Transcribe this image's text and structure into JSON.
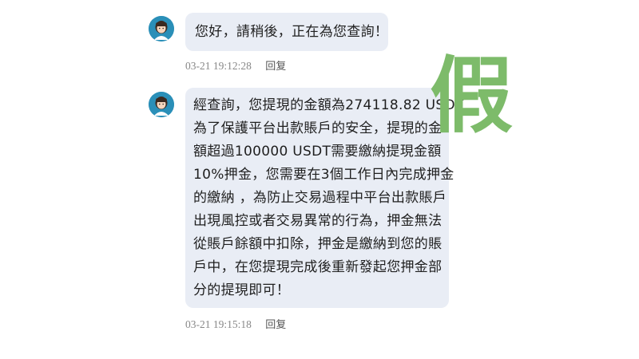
{
  "messages": [
    {
      "lines": [
        "您好，請稍後，正在為您查詢！"
      ],
      "time": "03-21 19:12:28",
      "reply_label": "回复"
    },
    {
      "lines": [
        "經查詢，您提現的金額為274118.82 USDT",
        "為了保護平台出款賬戶的安全，提現的金",
        "額超過100000 USDT需要繳納提現金額",
        "10%押金，您需要在3個工作日內完成押金",
        "的繳納 ，為防止交易過程中平台出款賬戶",
        "出現風控或者交易異常的行為，押金無法",
        "從賬戶餘額中扣除，押金是繳納到您的賬",
        "戶中，在您提現完成後重新發起您押金部",
        "分的提現即可！"
      ],
      "time": "03-21 19:15:18",
      "reply_label": "回复"
    }
  ],
  "overlay": {
    "stamp_text": "假",
    "stamp_color": "#7dbb6a"
  },
  "colors": {
    "bubble_bg": "#e9edf5",
    "avatar_bg": "#2a8fb8"
  }
}
